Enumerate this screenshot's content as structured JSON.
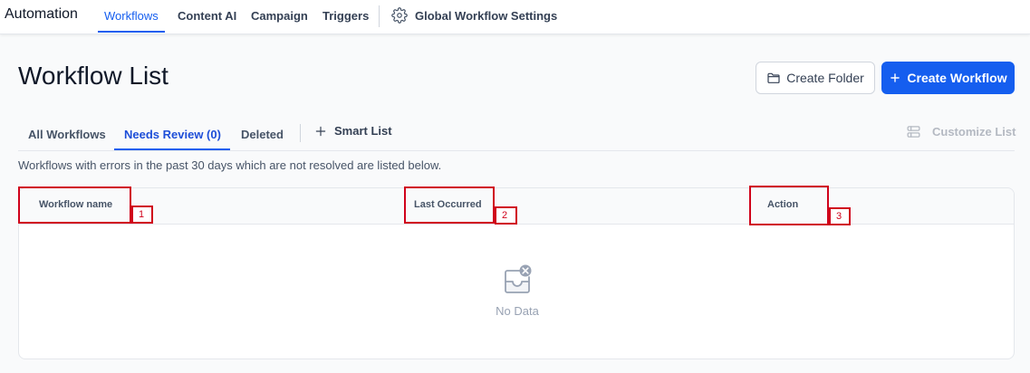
{
  "topnav": {
    "brand": "Automation",
    "tabs": [
      {
        "label": "Workflows",
        "active": true
      },
      {
        "label": "Content AI",
        "active": false
      },
      {
        "label": "Campaign",
        "active": false
      },
      {
        "label": "Triggers",
        "active": false
      }
    ],
    "settings_label": "Global Workflow Settings",
    "settings_icon": "gear-icon"
  },
  "page": {
    "title": "Workflow List",
    "create_folder_label": "Create Folder",
    "create_folder_icon": "folder-icon",
    "create_workflow_label": "Create Workflow",
    "create_workflow_icon": "plus-icon"
  },
  "subtabs": {
    "items": [
      {
        "label": "All Workflows",
        "active": false
      },
      {
        "label": "Needs Review (0)",
        "active": true
      },
      {
        "label": "Deleted",
        "active": false
      }
    ],
    "smart_list_label": "Smart List",
    "customize_label": "Customize List",
    "customize_icon": "columns-icon"
  },
  "description": "Workflows with errors in the past 30 days which are not resolved are listed below.",
  "table": {
    "columns": [
      "Workflow name",
      "Last Occurred",
      "Action"
    ],
    "empty_text": "No Data",
    "empty_icon": "empty-inbox-icon"
  },
  "annotations": [
    "1",
    "2",
    "3"
  ],
  "colors": {
    "accent": "#155eef",
    "annotation": "#d0021b",
    "muted": "#98a2b3"
  }
}
